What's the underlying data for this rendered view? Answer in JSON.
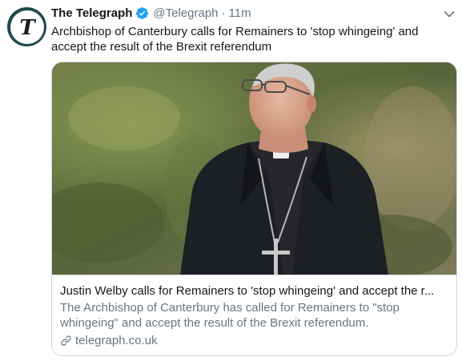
{
  "tweet": {
    "author_name": "The Telegraph",
    "author_handle": "@Telegraph",
    "separator": "·",
    "time": "11m",
    "text": "Archbishop of Canterbury calls for Remainers to 'stop whingeing' and accept the result of the Brexit referendum"
  },
  "avatar": {
    "letter": "T",
    "ring_color": "#1f4a4d"
  },
  "card": {
    "title": "Justin Welby calls for Remainers to 'stop whingeing' and accept the r...",
    "description": "The Archbishop of Canterbury has called for Remainers to \"stop whingeing\" and accept the result of the Brexit referendum.",
    "domain": "telegraph.co.uk"
  },
  "colors": {
    "verified": "#1da1f2",
    "secondary_text": "#657786",
    "primary_text": "#14171a",
    "border": "#ccd6dd"
  },
  "icons": {
    "verified": "verified-badge-icon",
    "caret": "chevron-down-icon",
    "link": "link-icon"
  }
}
